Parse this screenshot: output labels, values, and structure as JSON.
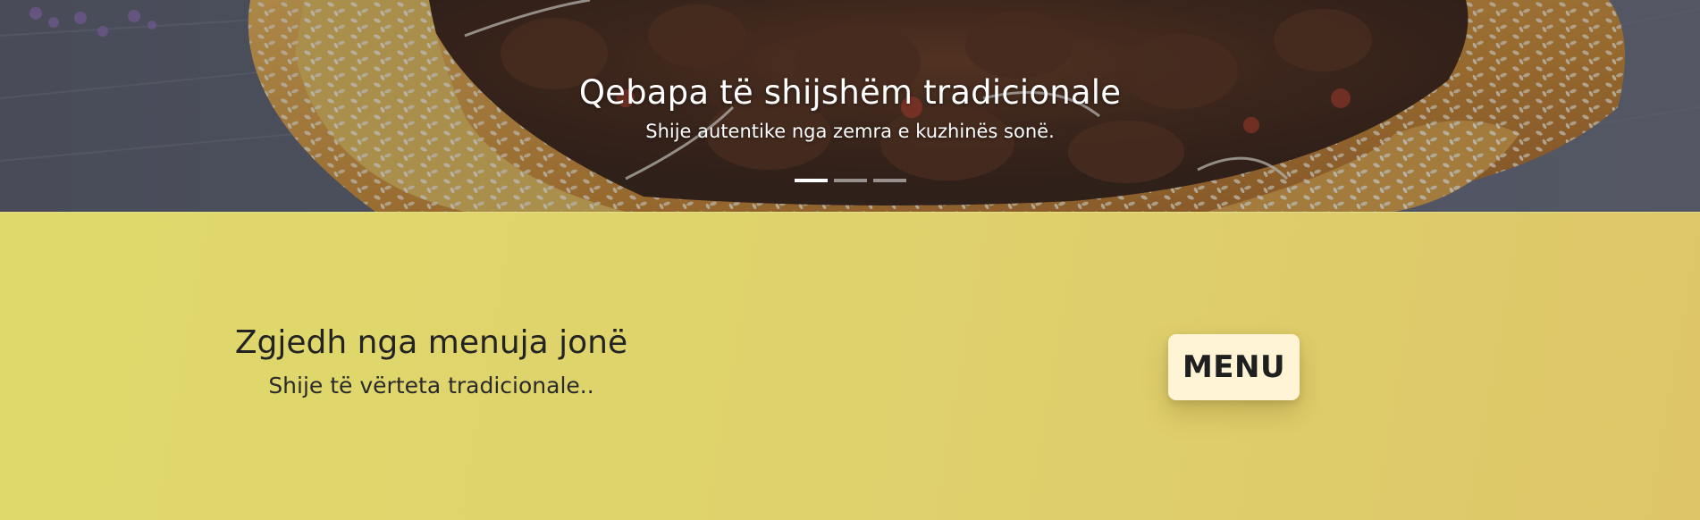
{
  "hero": {
    "title": "Qebapa të shijshëm tradicionale",
    "subtitle": "Shije autentike nga zemra e kuzhinës sonë.",
    "slides": [
      {
        "active": true
      },
      {
        "active": false
      },
      {
        "active": false
      }
    ]
  },
  "menu_section": {
    "title": "Zgjedh nga menuja jonë",
    "subtitle": "Shije të vërteta tradicionale..",
    "button_label": "MENU"
  },
  "colors": {
    "section_background": "#dfd56c",
    "button_background": "#fff5d6",
    "text_dark": "#232323",
    "hero_text": "#ffffff"
  }
}
